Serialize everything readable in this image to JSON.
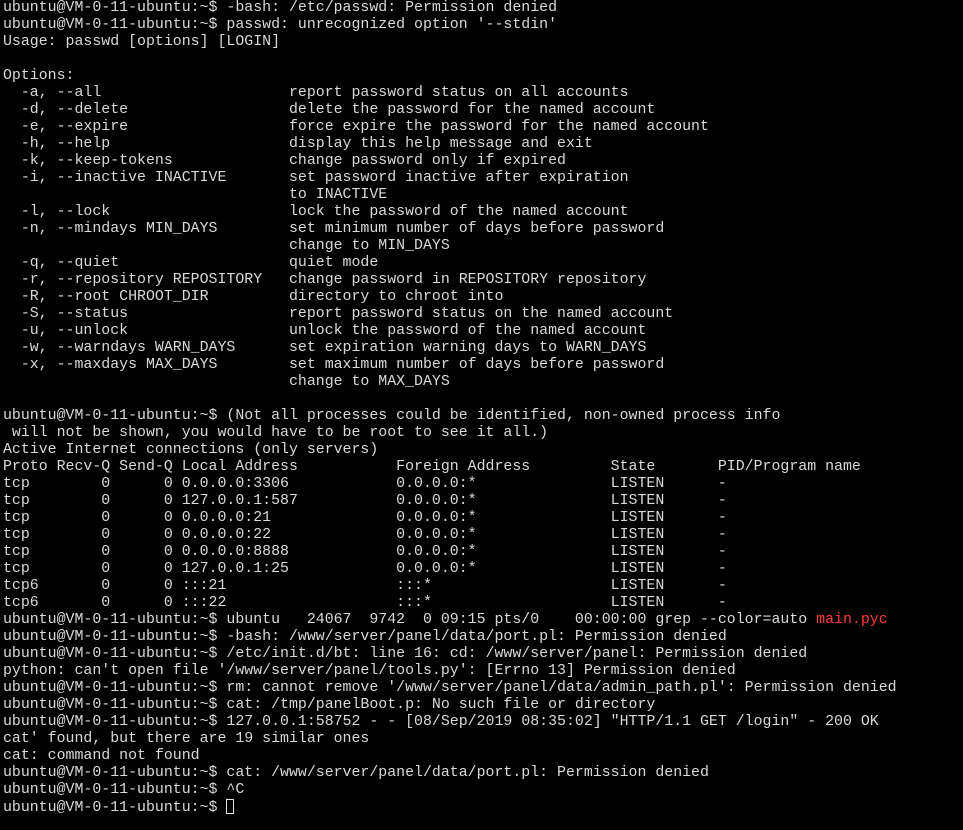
{
  "terminal": {
    "lines": [
      "ubuntu@VM-0-11-ubuntu:~$ -bash: /etc/passwd: Permission denied",
      "ubuntu@VM-0-11-ubuntu:~$ passwd: unrecognized option '--stdin'",
      "Usage: passwd [options] [LOGIN]",
      "",
      "Options:",
      "  -a, --all                     report password status on all accounts",
      "  -d, --delete                  delete the password for the named account",
      "  -e, --expire                  force expire the password for the named account",
      "  -h, --help                    display this help message and exit",
      "  -k, --keep-tokens             change password only if expired",
      "  -i, --inactive INACTIVE       set password inactive after expiration",
      "                                to INACTIVE",
      "  -l, --lock                    lock the password of the named account",
      "  -n, --mindays MIN_DAYS        set minimum number of days before password",
      "                                change to MIN_DAYS",
      "  -q, --quiet                   quiet mode",
      "  -r, --repository REPOSITORY   change password in REPOSITORY repository",
      "  -R, --root CHROOT_DIR         directory to chroot into",
      "  -S, --status                  report password status on the named account",
      "  -u, --unlock                  unlock the password of the named account",
      "  -w, --warndays WARN_DAYS      set expiration warning days to WARN_DAYS",
      "  -x, --maxdays MAX_DAYS        set maximum number of days before password",
      "                                change to MAX_DAYS",
      "",
      "ubuntu@VM-0-11-ubuntu:~$ (Not all processes could be identified, non-owned process info",
      " will not be shown, you would have to be root to see it all.)",
      "Active Internet connections (only servers)",
      "Proto Recv-Q Send-Q Local Address           Foreign Address         State       PID/Program name",
      "tcp        0      0 0.0.0.0:3306            0.0.0.0:*               LISTEN      -",
      "tcp        0      0 127.0.0.1:587           0.0.0.0:*               LISTEN      -",
      "tcp        0      0 0.0.0.0:21              0.0.0.0:*               LISTEN      -",
      "tcp        0      0 0.0.0.0:22              0.0.0.0:*               LISTEN      -",
      "tcp        0      0 0.0.0.0:8888            0.0.0.0:*               LISTEN      -",
      "tcp        0      0 127.0.0.1:25            0.0.0.0:*               LISTEN      -",
      "tcp6       0      0 :::21                   :::*                    LISTEN      -",
      "tcp6       0      0 :::22                   :::*                    LISTEN      -"
    ],
    "grep_line": {
      "text": "ubuntu@VM-0-11-ubuntu:~$ ubuntu   24067  9742  0 09:15 pts/0    00:00:00 grep --color=auto ",
      "match": "main.pyc"
    },
    "lines_after": [
      "ubuntu@VM-0-11-ubuntu:~$ -bash: /www/server/panel/data/port.pl: Permission denied",
      "ubuntu@VM-0-11-ubuntu:~$ /etc/init.d/bt: line 16: cd: /www/server/panel: Permission denied",
      "python: can't open file '/www/server/panel/tools.py': [Errno 13] Permission denied",
      "ubuntu@VM-0-11-ubuntu:~$ rm: cannot remove '/www/server/panel/data/admin_path.pl': Permission denied",
      "ubuntu@VM-0-11-ubuntu:~$ cat: /tmp/panelBoot.p: No such file or directory",
      "ubuntu@VM-0-11-ubuntu:~$ 127.0.0.1:58752 - - [08/Sep/2019 08:35:02] \"HTTP/1.1 GET /login\" - 200 OK",
      "cat' found, but there are 19 similar ones",
      "cat: command not found",
      "ubuntu@VM-0-11-ubuntu:~$ cat: /www/server/panel/data/port.pl: Permission denied",
      "ubuntu@VM-0-11-ubuntu:~$ ^C"
    ],
    "prompt": "ubuntu@VM-0-11-ubuntu:~$ ",
    "colors": {
      "background": "#000000",
      "foreground": "#d9d9d9",
      "grep_match": "#ff3b3b"
    }
  }
}
